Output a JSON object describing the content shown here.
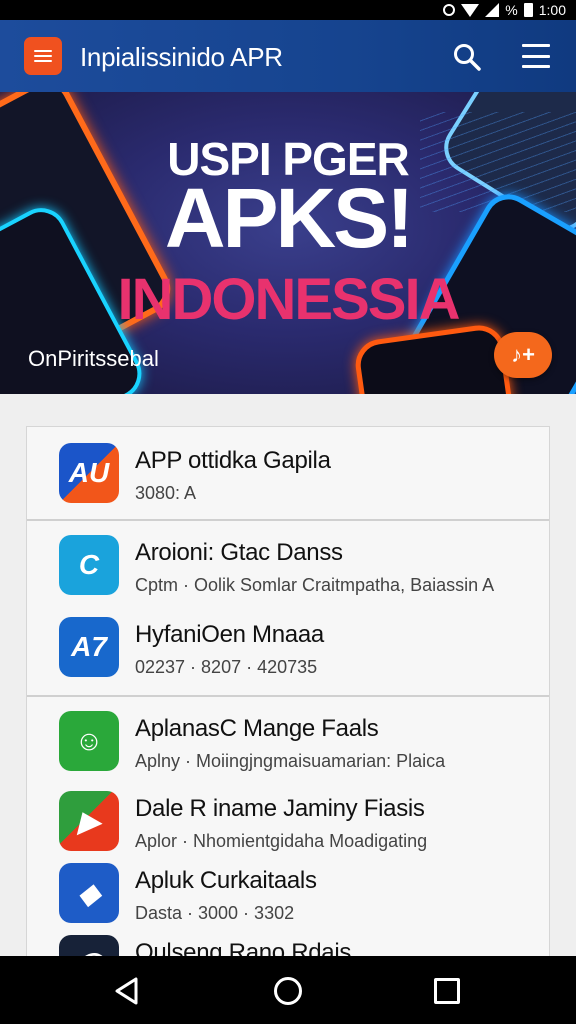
{
  "status_bar": {
    "battery_text": "%",
    "time": "1:00"
  },
  "app_bar": {
    "title": "Inpialissinido APR"
  },
  "banner": {
    "line1": "USPI PGER",
    "line2": "APKS!",
    "line3": "INDONESSIA",
    "caption": "OnPiritssebal",
    "fab_label": "♪+"
  },
  "apps": [
    {
      "title": "APP ottidka Gapila",
      "subtitle": "3080: A",
      "icon": "au-logo-icon",
      "glyph": "AU",
      "accent": "#1b55c9"
    },
    {
      "title": "Aroioni: Gtac Danss",
      "subtitle": "Cptm · Oolik Somlar Craitmpatha, Baiassin A",
      "icon": "refresh-c-icon",
      "glyph": "C",
      "accent": "#1aa3dc"
    },
    {
      "title": "HyfaniOen Mnaaa",
      "subtitle": "02237 · 8207 · 420735",
      "icon": "a7-logo-icon",
      "glyph": "A7",
      "accent": "#1868cc"
    },
    {
      "title": "AplanasC Mange Faals",
      "subtitle": "Aplny · Moiingjngmaisuamarian: Plaica",
      "icon": "green-chat-icon",
      "glyph": "☺",
      "accent": "#2aa83a"
    },
    {
      "title": "Dale R iname Jaminy Fiasis",
      "subtitle": "Aplor · Nhomientgidaha Moadigating",
      "icon": "play-arrow-icon",
      "glyph": "▶",
      "accent": "#e8391d"
    },
    {
      "title": "Apluk Curkaitaals",
      "subtitle": "Dasta · 3000 · 3302",
      "icon": "cube-box-icon",
      "glyph": "◆",
      "accent": "#1e5cc7"
    },
    {
      "title": "Oulseng Rano Rdais",
      "subtitle": "",
      "icon": "dark-ring-icon",
      "glyph": "◯",
      "accent": "#172238"
    }
  ]
}
